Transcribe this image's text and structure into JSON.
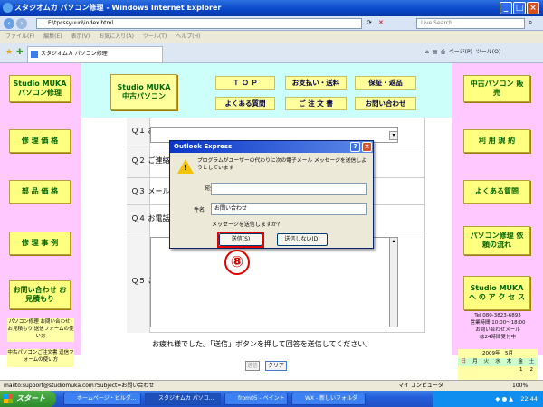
{
  "window": {
    "title": "スタジオムカ パソコン修理 - Windows Internet Explorer",
    "address": "F:\\tpcssyuuri\\index.html",
    "search_placeholder": "Live Search",
    "menu": [
      "ファイル(F)",
      "編集(E)",
      "表示(V)",
      "お気に入り(A)",
      "ツール(T)",
      "ヘルプ(H)"
    ],
    "tab_label": "スタジオムカ パソコン修理",
    "toolbar": {
      "page_label": "ページ(P)",
      "tools_label": "ツール(O)"
    }
  },
  "header": {
    "logo_line1": "Studio MUKA",
    "logo_line2": "中古パソコン",
    "nav": [
      "Ｔ Ｏ Ｐ",
      "お支払い・送料",
      "保証・返品",
      "よくある質問",
      "ご 注 文 書",
      "お問い合わせ"
    ]
  },
  "left_sidebar": {
    "items": [
      "Studio MUKA パソコン修理",
      "修 理 価 格",
      "部 品 価 格",
      "修 理 事 例",
      "お問い合わせ お見積もり"
    ],
    "note1": "パソコン修理 お問い合わせ･お見積もり 送信フォームの使い方",
    "note2": "中古パソコンご注文書 送信フォームの使い方"
  },
  "right_sidebar": {
    "items": [
      "中古パソコン 販　売",
      "利 用 規 約",
      "よくある質問",
      "パソコン修理 依頼の流れ",
      "Studio MUKA へ の ア ク セ ス"
    ],
    "contact": [
      "Tel 080-3823-6893",
      "営業時間 10:00〜18:00",
      "お問い合わせメール",
      "は24時間受付中"
    ],
    "calendar": {
      "month": "2009年　5月",
      "weekdays": [
        "日",
        "月",
        "火",
        "水",
        "木",
        "金",
        "土"
      ],
      "days": [
        "1",
        "2"
      ]
    }
  },
  "form": {
    "q1": "Ｑ１ お名前",
    "q2": "Ｑ２ ご連絡",
    "q3": "Ｑ３ メール",
    "q4": "Ｑ４ お電話",
    "q5": "Ｑ５ ご質問",
    "footer_text": "お疲れ様でした。「送信」ボタンを押して回答を送信してください。",
    "send_label": "送信",
    "clear_label": "クリア"
  },
  "dialog": {
    "title": "Outlook Express",
    "message": "プログラムがユーザーの代わりに次の電子メール メッセージを送信しようとしています",
    "to_label": "宛先",
    "to_value": "",
    "subject_label": "件名",
    "subject_value": "お問い合わせ",
    "question": "メッセージを送信しますか?",
    "send_button": "送信(S)",
    "nosend_button": "送信しない(D)"
  },
  "annotation": {
    "number": "⑧"
  },
  "status": {
    "left": "mailto:support@studiomuka.com?Subject=お問い合わせ",
    "zone": "マイ コンピュータ",
    "zoom": "100%"
  },
  "taskbar": {
    "start": "スタート",
    "tasks": [
      "ホームページ・ビルダ...",
      "スタジオムカ パソコ...",
      "from05 - ペイント",
      "WX - 新しいフォルダ"
    ],
    "time": "22:44"
  },
  "colors": {
    "sidebar": "#ffc9ff",
    "band": "#ccfffa",
    "nav_button": "#ffff9c",
    "accent_red": "#e20000"
  }
}
